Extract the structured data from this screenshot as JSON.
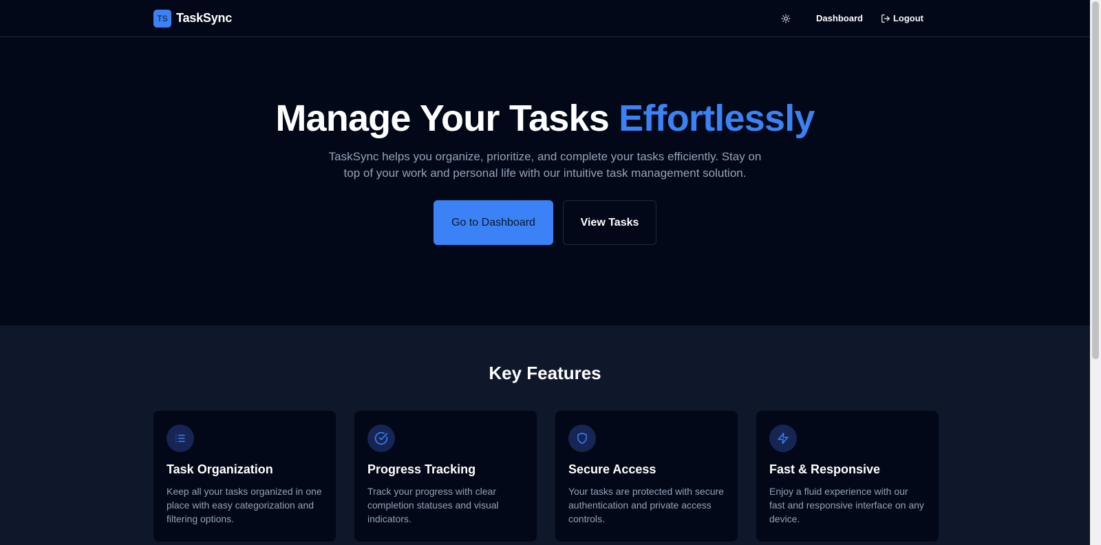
{
  "header": {
    "logo_badge": "TS",
    "brand": "TaskSync",
    "nav": {
      "theme_icon": "sun-icon",
      "dashboard": "Dashboard",
      "logout": "Logout",
      "logout_icon": "logout-icon"
    }
  },
  "hero": {
    "title_main": "Manage Your Tasks ",
    "title_accent": "Effortlessly",
    "subtitle": "TaskSync helps you organize, prioritize, and complete your tasks efficiently. Stay on top of your work and personal life with our intuitive task management solution.",
    "primary_button": "Go to Dashboard",
    "secondary_button": "View Tasks"
  },
  "features": {
    "title": "Key Features",
    "cards": [
      {
        "icon": "list-icon",
        "title": "Task Organization",
        "description": "Keep all your tasks organized in one place with easy categorization and filtering options."
      },
      {
        "icon": "check-circle-icon",
        "title": "Progress Tracking",
        "description": "Track your progress with clear completion statuses and visual indicators."
      },
      {
        "icon": "shield-icon",
        "title": "Secure Access",
        "description": "Your tasks are protected with secure authentication and private access controls."
      },
      {
        "icon": "lightning-icon",
        "title": "Fast & Responsive",
        "description": "Enjoy a fluid experience with our fast and responsive interface on any device."
      }
    ]
  },
  "colors": {
    "background": "#020817",
    "section_background": "#0f172a",
    "accent": "#3b82f6",
    "muted_text": "#94a3b8"
  }
}
